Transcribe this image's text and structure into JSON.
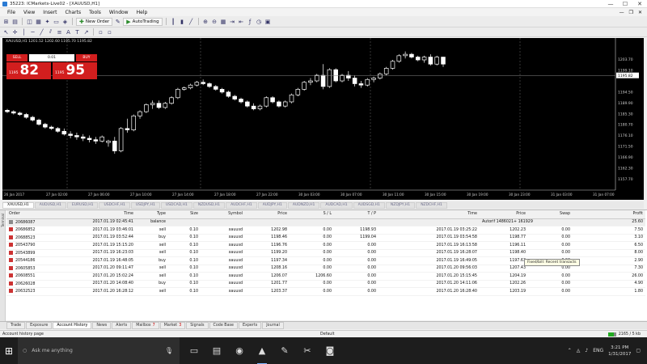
{
  "window": {
    "title": "35223: ICMarkets-Live02 - [XAUUSD,H1]",
    "controls": [
      "—",
      "☐",
      "✕"
    ]
  },
  "menu": {
    "items": [
      "File",
      "View",
      "Insert",
      "Charts",
      "Tools",
      "Window",
      "Help"
    ]
  },
  "toolbar": {
    "new_order_label": "New Order",
    "autotrading_label": "AutoTrading"
  },
  "chart": {
    "title": "XAUUSD,H1 1201.52 1202.60 1195.70 1195.82",
    "one_click": {
      "sell_label": "SELL",
      "buy_label": "BUY",
      "volume": "0.01",
      "sell_prefix": "1195",
      "sell_big": "82",
      "buy_prefix": "1195",
      "buy_big": "95"
    },
    "price_labels": [
      "1203.70",
      "1199.10",
      "1195.82",
      "1194.50",
      "1189.90",
      "1185.30",
      "1180.70",
      "1176.10",
      "1171.50",
      "1166.90",
      "1162.30",
      "1157.70"
    ],
    "time_labels": [
      "26 Jan 2017",
      "27 Jan 02:00",
      "27 Jan 06:00",
      "27 Jan 10:00",
      "27 Jan 14:00",
      "27 Jan 18:00",
      "27 Jan 22:00",
      "30 Jan 03:00",
      "30 Jan 07:00",
      "30 Jan 11:00",
      "30 Jan 15:00",
      "30 Jan 19:00",
      "30 Jan 23:00",
      "31 Jan 03:00",
      "31 Jan 07:00"
    ]
  },
  "chart_data": {
    "type": "candlestick",
    "title": "XAUUSD,H1",
    "xlabel": "",
    "ylabel": "",
    "ylim": [
      1155,
      1207
    ],
    "candles": [
      [
        1183.5,
        1184.0,
        1182.5,
        1183.0
      ],
      [
        1183.0,
        1183.5,
        1182.0,
        1182.5
      ],
      [
        1182.5,
        1183.0,
        1181.5,
        1182.0
      ],
      [
        1182.0,
        1182.5,
        1180.5,
        1181.0
      ],
      [
        1181.0,
        1181.5,
        1179.5,
        1180.0
      ],
      [
        1180.0,
        1180.5,
        1178.0,
        1178.5
      ],
      [
        1178.5,
        1179.0,
        1177.0,
        1177.5
      ],
      [
        1177.5,
        1178.0,
        1176.5,
        1177.0
      ],
      [
        1177.0,
        1177.5,
        1175.5,
        1176.0
      ],
      [
        1176.0,
        1177.0,
        1174.5,
        1175.0
      ],
      [
        1175.0,
        1176.0,
        1173.5,
        1174.5
      ],
      [
        1174.5,
        1175.5,
        1173.0,
        1174.0
      ],
      [
        1174.0,
        1175.0,
        1172.5,
        1173.5
      ],
      [
        1173.5,
        1174.5,
        1172.0,
        1173.0
      ],
      [
        1173.0,
        1174.0,
        1171.5,
        1172.5
      ],
      [
        1172.5,
        1174.5,
        1172.0,
        1174.0
      ],
      [
        1172.0,
        1173.0,
        1170.5,
        1172.5
      ],
      [
        1172.5,
        1174.0,
        1168.0,
        1169.0
      ],
      [
        1169.0,
        1177.5,
        1168.5,
        1177.0
      ],
      [
        1177.0,
        1180.5,
        1175.5,
        1176.5
      ],
      [
        1176.5,
        1182.0,
        1176.0,
        1181.5
      ],
      [
        1181.5,
        1183.5,
        1180.5,
        1183.0
      ],
      [
        1183.0,
        1186.0,
        1182.5,
        1185.5
      ],
      [
        1185.5,
        1187.0,
        1184.0,
        1186.0
      ],
      [
        1186.0,
        1187.0,
        1184.0,
        1184.5
      ],
      [
        1184.5,
        1186.5,
        1184.0,
        1186.0
      ],
      [
        1186.0,
        1188.5,
        1185.5,
        1188.0
      ],
      [
        1188.0,
        1191.5,
        1187.5,
        1191.0
      ],
      [
        1191.0,
        1192.0,
        1190.5,
        1191.5
      ],
      [
        1191.5,
        1193.0,
        1191.0,
        1192.5
      ],
      [
        1192.5,
        1194.0,
        1192.0,
        1193.5
      ],
      [
        1193.5,
        1194.5,
        1192.5,
        1193.0
      ],
      [
        1193.0,
        1193.5,
        1191.5,
        1192.0
      ],
      [
        1192.0,
        1192.5,
        1190.5,
        1191.0
      ],
      [
        1191.0,
        1191.5,
        1189.5,
        1190.0
      ],
      [
        1190.0,
        1190.5,
        1188.0,
        1188.5
      ],
      [
        1188.5,
        1189.0,
        1187.0,
        1187.5
      ],
      [
        1187.5,
        1188.0,
        1186.0,
        1186.5
      ],
      [
        1186.5,
        1187.0,
        1184.5,
        1185.0
      ],
      [
        1185.0,
        1186.0,
        1183.5,
        1184.0
      ],
      [
        1184.0,
        1185.5,
        1183.5,
        1185.0
      ],
      [
        1185.0,
        1188.5,
        1184.5,
        1188.0
      ],
      [
        1188.0,
        1188.5,
        1186.0,
        1186.5
      ],
      [
        1186.5,
        1187.0,
        1184.5,
        1185.0
      ],
      [
        1185.0,
        1187.0,
        1184.5,
        1186.5
      ],
      [
        1186.5,
        1189.5,
        1186.0,
        1189.0
      ],
      [
        1189.0,
        1191.5,
        1188.5,
        1191.0
      ],
      [
        1191.0,
        1194.0,
        1190.5,
        1193.5
      ],
      [
        1193.5,
        1195.0,
        1192.5,
        1194.0
      ],
      [
        1194.0,
        1196.5,
        1193.5,
        1196.0
      ],
      [
        1196.0,
        1200.0,
        1191.0,
        1192.0
      ],
      [
        1192.0,
        1198.5,
        1191.5,
        1198.0
      ],
      [
        1198.0,
        1198.5,
        1193.5,
        1194.0
      ],
      [
        1194.0,
        1196.5,
        1193.5,
        1196.0
      ],
      [
        1196.0,
        1197.5,
        1194.0,
        1195.0
      ],
      [
        1195.0,
        1196.0,
        1192.0,
        1193.0
      ],
      [
        1193.0,
        1194.0,
        1191.5,
        1192.5
      ],
      [
        1192.5,
        1195.0,
        1192.0,
        1194.5
      ],
      [
        1194.5,
        1195.5,
        1193.5,
        1195.0
      ],
      [
        1195.0,
        1197.0,
        1194.5,
        1196.5
      ],
      [
        1196.5,
        1199.0,
        1196.0,
        1198.5
      ],
      [
        1198.5,
        1201.5,
        1198.0,
        1201.0
      ],
      [
        1201.0,
        1203.5,
        1200.5,
        1203.0
      ],
      [
        1203.0,
        1204.5,
        1202.0,
        1203.5
      ],
      [
        1203.5,
        1204.0,
        1202.0,
        1202.5
      ],
      [
        1202.5,
        1203.0,
        1201.0,
        1201.5
      ],
      [
        1201.5,
        1203.0,
        1200.5,
        1202.5
      ],
      [
        1202.5,
        1203.5,
        1199.5,
        1200.0
      ],
      [
        1200.0,
        1203.0,
        1199.5,
        1202.5
      ],
      [
        1202.5,
        1202.6,
        1199.0,
        1200.0
      ]
    ],
    "current_price": 1195.82
  },
  "chart_tabs": [
    "XAUUSD,H1",
    "AUDUSD,H1",
    "EURUSD,H1",
    "USDCHF,H1",
    "USDJPY,H1",
    "USDCAD,H1",
    "NZDUSD,H1",
    "AUDCHF,H1",
    "AUDJPY,H1",
    "AUDNZD,H1",
    "AUDCAD,H1",
    "AUDSGD,H1",
    "NZDJPY,H1",
    "NZDCHF,H1"
  ],
  "history": {
    "headers": [
      "Order",
      "Time",
      "Type",
      "Size",
      "Symbol",
      "Price",
      "S / L",
      "T / P",
      "Time",
      "Price",
      "Swap",
      "Profit"
    ],
    "rows": [
      {
        "order": "20686087",
        "time": "2017.01.19 02:45:41",
        "type": "balance",
        "size": "",
        "symbol": "",
        "price": "",
        "sl": "",
        "tp": "",
        "ctime": "",
        "cprice": "Autorif 1486021+ 161929",
        "swap": "",
        "profit": "25.60",
        "balance": true
      },
      {
        "order": "20686852",
        "time": "2017.01.19 03:46:01",
        "type": "sell",
        "size": "0.10",
        "symbol": "xauusd",
        "price": "1202.98",
        "sl": "0.00",
        "tp": "1198.93",
        "ctime": "2017.01.19 03:25:22",
        "cprice": "1202.23",
        "swap": "0.00",
        "profit": "7.50"
      },
      {
        "order": "20688523",
        "time": "2017.01.19 03:52:44",
        "type": "buy",
        "size": "0.10",
        "symbol": "xauusd",
        "price": "1198.46",
        "sl": "0.00",
        "tp": "1199.04",
        "ctime": "2017.01.19 03:54:58",
        "cprice": "1198.77",
        "swap": "0.00",
        "profit": "3.10"
      },
      {
        "order": "20543790",
        "time": "2017.01.19 15:15:20",
        "type": "sell",
        "size": "0.10",
        "symbol": "xauusd",
        "price": "1196.76",
        "sl": "0.00",
        "tp": "0.00",
        "ctime": "2017.01.19 16:13:58",
        "cprice": "1196.11",
        "swap": "0.00",
        "profit": "6.50"
      },
      {
        "order": "20543899",
        "time": "2017.01.19 16:23:03",
        "type": "sell",
        "size": "0.10",
        "symbol": "xauusd",
        "price": "1199.20",
        "sl": "0.00",
        "tp": "0.00",
        "ctime": "2017.01.19 16:28:07",
        "cprice": "1198.40",
        "swap": "0.00",
        "profit": "8.00"
      },
      {
        "order": "20544186",
        "time": "2017.01.19 16:48:05",
        "type": "buy",
        "size": "0.10",
        "symbol": "xauusd",
        "price": "1197.34",
        "sl": "0.00",
        "tp": "0.00",
        "ctime": "2017.01.19 16:49:05",
        "cprice": "1197.63",
        "swap": "0.00",
        "profit": "2.90"
      },
      {
        "order": "20605853",
        "time": "2017.01.20 09:11:47",
        "type": "sell",
        "size": "0.10",
        "symbol": "xauusd",
        "price": "1208.16",
        "sl": "0.00",
        "tp": "0.00",
        "ctime": "2017.01.20 09:56:03",
        "cprice": "1207.43",
        "swap": "0.00",
        "profit": "7.30"
      },
      {
        "order": "20608551",
        "time": "2017.01.20 15:02:24",
        "type": "sell",
        "size": "0.10",
        "symbol": "xauusd",
        "price": "1206.07",
        "sl": "1206.60",
        "tp": "0.00",
        "ctime": "2017.01.20 15:15:45",
        "cprice": "1204.19",
        "swap": "0.00",
        "profit": "26.00"
      },
      {
        "order": "20626028",
        "time": "2017.01.20 14:08:40",
        "type": "buy",
        "size": "0.10",
        "symbol": "xauusd",
        "price": "1201.77",
        "sl": "0.00",
        "tp": "0.00",
        "ctime": "2017.01.20 14:11:06",
        "cprice": "1202.26",
        "swap": "0.00",
        "profit": "4.90"
      },
      {
        "order": "20632523",
        "time": "2017.01.20 16:28:12",
        "type": "sell",
        "size": "0.10",
        "symbol": "xauusd",
        "price": "1203.37",
        "sl": "0.00",
        "tp": "0.00",
        "ctime": "2017.01.20 16:28:40",
        "cprice": "1203.19",
        "swap": "0.00",
        "profit": "1.80"
      }
    ],
    "tooltip": "Fixed/bill: Recent transacts"
  },
  "terminal": {
    "side_label": "Terminal",
    "tabs": [
      {
        "label": "Trade",
        "badge": ""
      },
      {
        "label": "Exposure",
        "badge": ""
      },
      {
        "label": "Account History",
        "badge": "",
        "active": true
      },
      {
        "label": "News",
        "badge": ""
      },
      {
        "label": "Alerts",
        "badge": ""
      },
      {
        "label": "Mailbox",
        "badge": "7"
      },
      {
        "label": "Market",
        "badge": "3"
      },
      {
        "label": "Signals",
        "badge": ""
      },
      {
        "label": "Code Base",
        "badge": ""
      },
      {
        "label": "Experts",
        "badge": ""
      },
      {
        "label": "Journal",
        "badge": ""
      }
    ]
  },
  "status": {
    "left": "Account history page",
    "mid": "Default",
    "right": "2165 / 5 kb"
  },
  "taskbar": {
    "search_placeholder": "Ask me anything",
    "lang": "ENG",
    "time": "3:21 PM",
    "date": "1/31/2017"
  }
}
